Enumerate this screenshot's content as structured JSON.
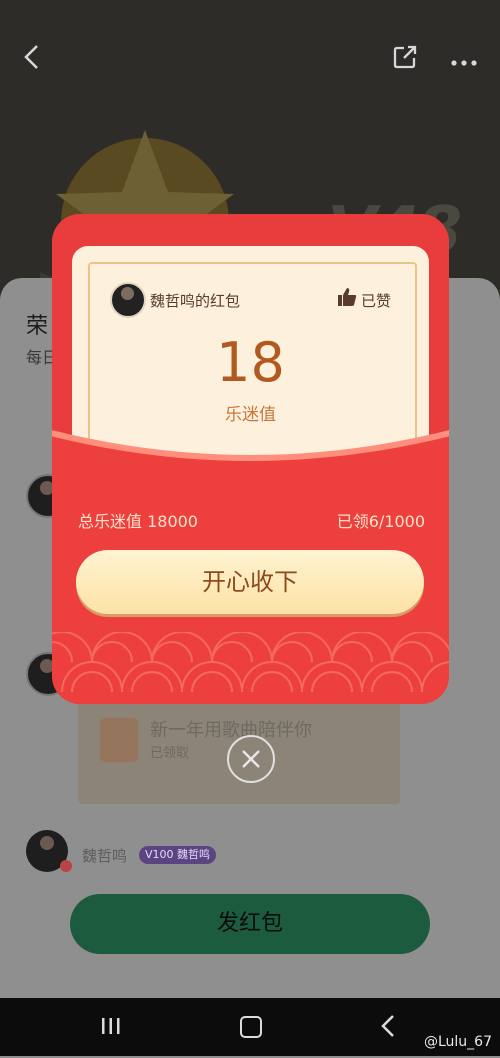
{
  "header": {
    "level_text": "V48"
  },
  "sheet": {
    "title": "荣",
    "subtitle": "每日"
  },
  "background_card": {
    "title": "新一年用歌曲陪伴你",
    "status": "已领取"
  },
  "sender": {
    "name": "魏哲鸣",
    "vip_badge": "V100 魏哲鸣"
  },
  "send_button_label": "发红包",
  "envelope": {
    "owner_label": "魏哲鸣的红包",
    "like_label": "已赞",
    "amount": "18",
    "amount_unit": "乐迷值",
    "total_label": "总乐迷值 18000",
    "claimed_label": "已领6/1000",
    "accept_label": "开心收下"
  },
  "watermark": "@Lulu_67",
  "colors": {
    "envelope_red": "#e53b3b",
    "letter_cream": "#fdf1dd",
    "amount_brown": "#b15a1f",
    "accept_button": "#fde2a6"
  }
}
